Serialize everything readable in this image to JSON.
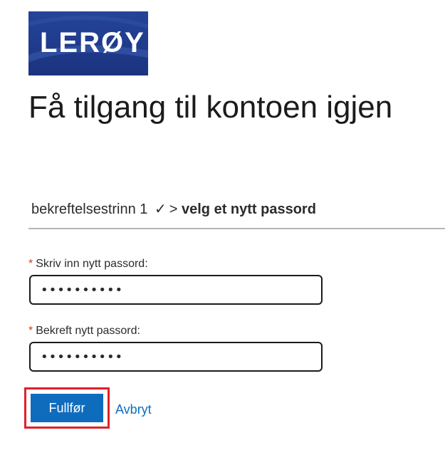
{
  "brand": {
    "logo_text": "LERØY",
    "colors": {
      "logo_background": "#1f3a8a",
      "primary_button": "#0f6cbd",
      "link": "#0b6ec4",
      "required_marker": "#d83b01",
      "highlight_border": "#e0202a"
    }
  },
  "page": {
    "title": "Få tilgang til kontoen igjen"
  },
  "steps": {
    "completed": "bekreftelsestrinn 1",
    "check": "✓",
    "separator": ">",
    "current": "velg et nytt passord"
  },
  "form": {
    "required_marker": "*",
    "new_password": {
      "label": "Skriv inn nytt passord:",
      "value": "••••••••••"
    },
    "confirm_password": {
      "label": "Bekreft nytt passord:",
      "value": "••••••••••"
    }
  },
  "actions": {
    "submit_label": "Fullfør",
    "cancel_label": "Avbryt"
  }
}
